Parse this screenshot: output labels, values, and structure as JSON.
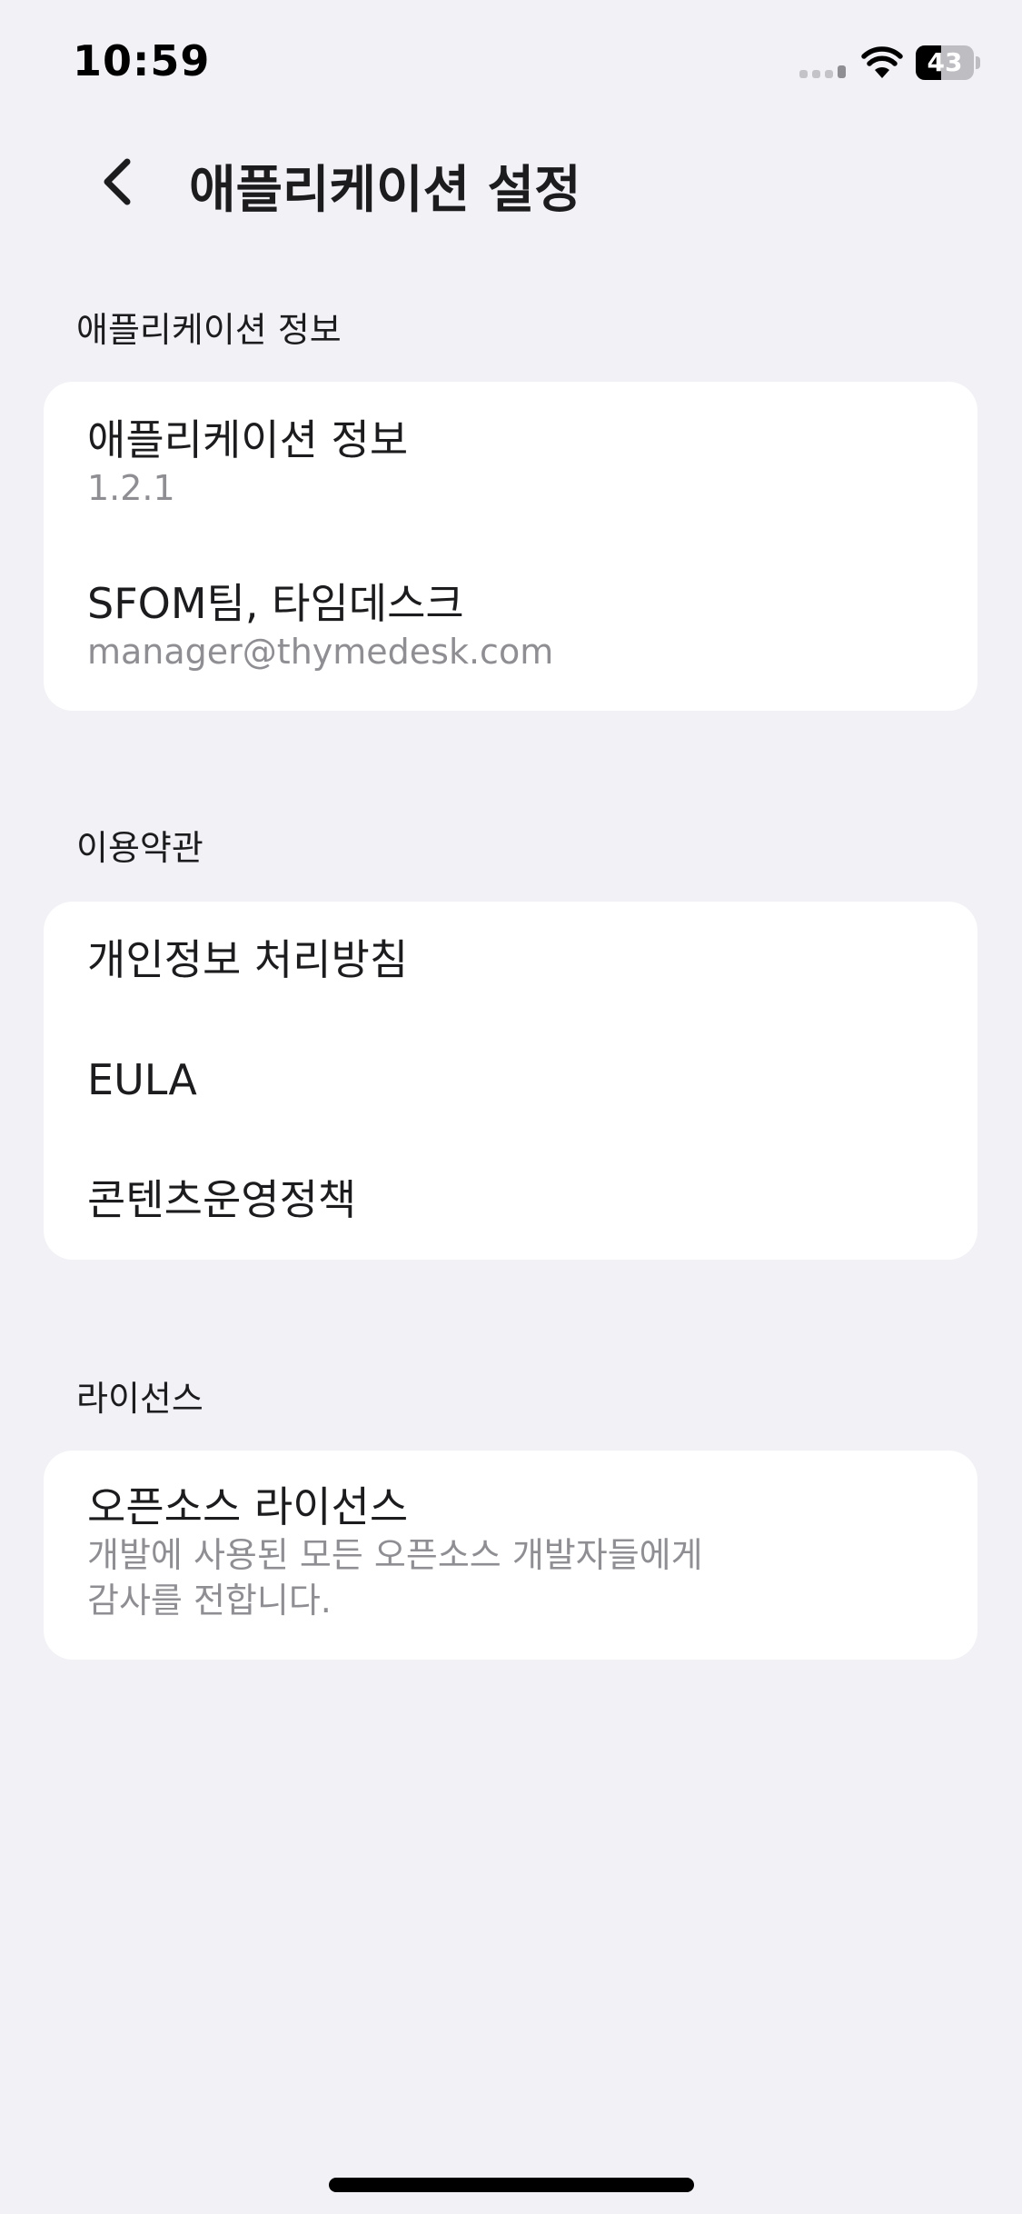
{
  "status_bar": {
    "time": "10:59",
    "battery_level": "43",
    "battery_fraction": 0.43,
    "icons": [
      "signal-icon",
      "wifi-icon",
      "battery-icon"
    ]
  },
  "header": {
    "back_icon": "chevron-left-icon",
    "title": "애플리케이션 설정"
  },
  "sections": [
    {
      "header": "애플리케이션 정보",
      "rows": [
        {
          "title": "애플리케이션 정보",
          "subtitle": "1.2.1"
        },
        {
          "title": "SFOM팀, 타임데스크",
          "subtitle": "manager@thymedesk.com"
        }
      ]
    },
    {
      "header": "이용약관",
      "rows": [
        {
          "title": "개인정보 처리방침"
        },
        {
          "title": "EULA"
        },
        {
          "title": "콘텐츠운영정책"
        }
      ]
    },
    {
      "header": "라이선스",
      "rows": [
        {
          "title": "오픈소스 라이선스",
          "subtitle_line1": "개발에 사용된 모든 오픈소스 개발자들에게",
          "subtitle_line2": "감사를 전합니다."
        }
      ]
    }
  ],
  "colors": {
    "background": "#f1f1f6",
    "card": "#ffffff",
    "text_primary": "#1c1c1e",
    "text_secondary": "#8e8e93"
  }
}
